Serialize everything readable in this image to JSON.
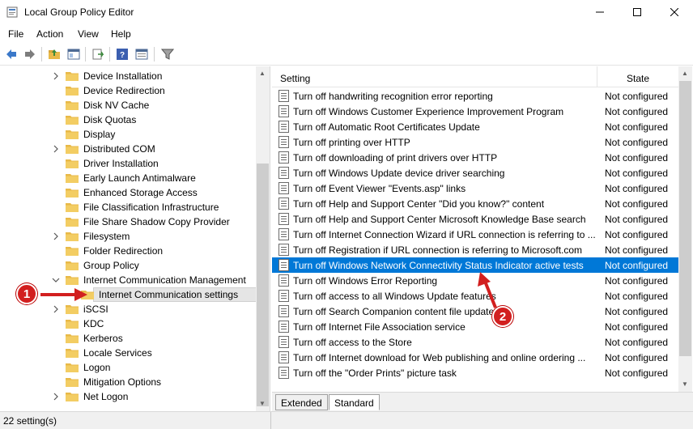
{
  "window": {
    "title": "Local Group Policy Editor"
  },
  "menu": [
    "File",
    "Action",
    "View",
    "Help"
  ],
  "tree": {
    "items": [
      {
        "label": "Device Installation",
        "expandable": true
      },
      {
        "label": "Device Redirection",
        "expandable": false
      },
      {
        "label": "Disk NV Cache",
        "expandable": false
      },
      {
        "label": "Disk Quotas",
        "expandable": false
      },
      {
        "label": "Display",
        "expandable": false
      },
      {
        "label": "Distributed COM",
        "expandable": true
      },
      {
        "label": "Driver Installation",
        "expandable": false
      },
      {
        "label": "Early Launch Antimalware",
        "expandable": false
      },
      {
        "label": "Enhanced Storage Access",
        "expandable": false
      },
      {
        "label": "File Classification Infrastructure",
        "expandable": false
      },
      {
        "label": "File Share Shadow Copy Provider",
        "expandable": false
      },
      {
        "label": "Filesystem",
        "expandable": true
      },
      {
        "label": "Folder Redirection",
        "expandable": false
      },
      {
        "label": "Group Policy",
        "expandable": false
      },
      {
        "label": "Internet Communication Management",
        "expandable": true,
        "expanded": true
      },
      {
        "label": "Internet Communication settings",
        "child": true,
        "selected": true
      },
      {
        "label": "iSCSI",
        "expandable": true
      },
      {
        "label": "KDC",
        "expandable": false
      },
      {
        "label": "Kerberos",
        "expandable": false
      },
      {
        "label": "Locale Services",
        "expandable": false
      },
      {
        "label": "Logon",
        "expandable": false
      },
      {
        "label": "Mitigation Options",
        "expandable": false
      },
      {
        "label": "Net Logon",
        "expandable": true
      }
    ]
  },
  "list": {
    "headers": {
      "setting": "Setting",
      "state": "State"
    },
    "rows": [
      {
        "setting": "Turn off handwriting recognition error reporting",
        "state": "Not configured"
      },
      {
        "setting": "Turn off Windows Customer Experience Improvement Program",
        "state": "Not configured"
      },
      {
        "setting": "Turn off Automatic Root Certificates Update",
        "state": "Not configured"
      },
      {
        "setting": "Turn off printing over HTTP",
        "state": "Not configured"
      },
      {
        "setting": "Turn off downloading of print drivers over HTTP",
        "state": "Not configured"
      },
      {
        "setting": "Turn off Windows Update device driver searching",
        "state": "Not configured"
      },
      {
        "setting": "Turn off Event Viewer \"Events.asp\" links",
        "state": "Not configured"
      },
      {
        "setting": "Turn off Help and Support Center \"Did you know?\" content",
        "state": "Not configured"
      },
      {
        "setting": "Turn off Help and Support Center Microsoft Knowledge Base search",
        "state": "Not configured"
      },
      {
        "setting": "Turn off Internet Connection Wizard if URL connection is referring to ...",
        "state": "Not configured"
      },
      {
        "setting": "Turn off Registration if URL connection is referring to Microsoft.com",
        "state": "Not configured"
      },
      {
        "setting": "Turn off Windows Network Connectivity Status Indicator active tests",
        "state": "Not configured",
        "selected": true
      },
      {
        "setting": "Turn off Windows Error Reporting",
        "state": "Not configured"
      },
      {
        "setting": "Turn off access to all Windows Update features",
        "state": "Not configured"
      },
      {
        "setting": "Turn off Search Companion content file updates",
        "state": "Not configured"
      },
      {
        "setting": "Turn off Internet File Association service",
        "state": "Not configured"
      },
      {
        "setting": "Turn off access to the Store",
        "state": "Not configured"
      },
      {
        "setting": "Turn off Internet download for Web publishing and online ordering ...",
        "state": "Not configured"
      },
      {
        "setting": "Turn off the \"Order Prints\" picture task",
        "state": "Not configured"
      }
    ]
  },
  "tabs": {
    "extended": "Extended",
    "standard": "Standard"
  },
  "status": {
    "text": "22 setting(s)"
  },
  "callouts": {
    "one": "1",
    "two": "2"
  },
  "colors": {
    "selection": "#0078d7",
    "callout": "#d21f1f",
    "folder": "#e8b948"
  }
}
